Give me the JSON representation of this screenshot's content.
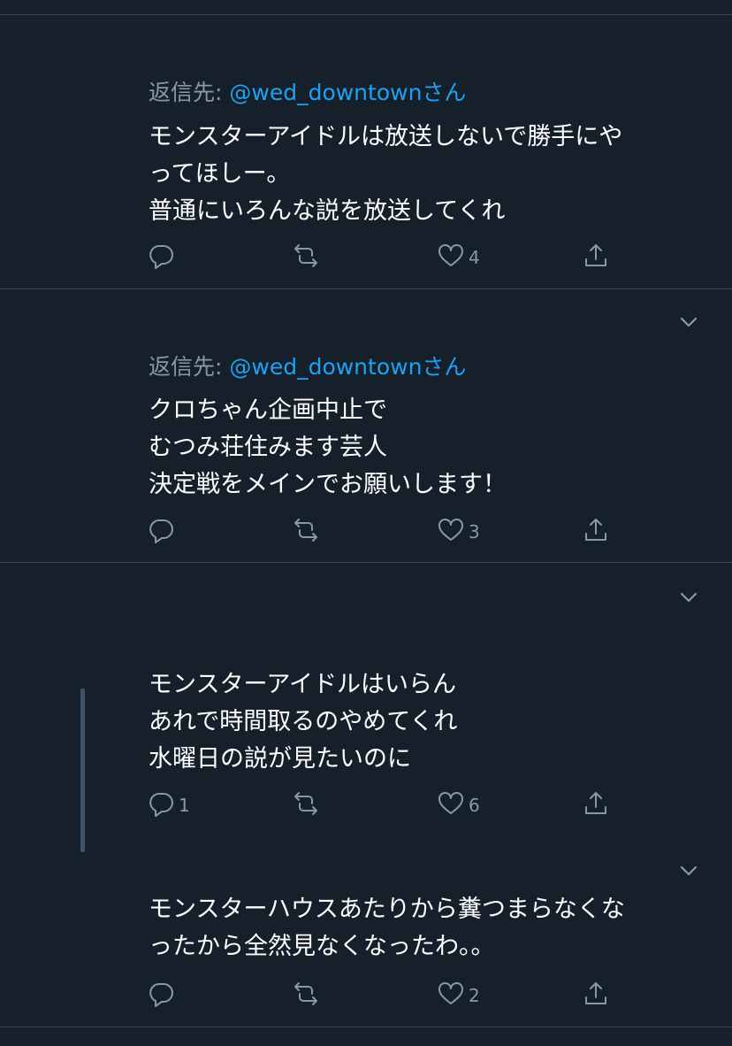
{
  "tweets": [
    {
      "reply_prefix": "返信先: ",
      "reply_handle": "@wed_downtownさん",
      "lines": [
        "モンスターアイドルは放送しないで勝手にや",
        "ってほしー。",
        "普通にいろんな説を放送してくれ"
      ],
      "reply_count": "",
      "like_count": "4"
    },
    {
      "reply_prefix": "返信先: ",
      "reply_handle": "@wed_downtownさん",
      "lines": [
        "クロちゃん企画中止で",
        "むつみ荘住みます芸人",
        "決定戦をメインでお願いします！"
      ],
      "reply_count": "",
      "like_count": "3"
    },
    {
      "lines": [
        "モンスターアイドルはいらん",
        "あれで時間取るのやめてくれ",
        "水曜日の説が見たいのに"
      ],
      "reply_count": "1",
      "like_count": "6"
    },
    {
      "lines": [
        "モンスターハウスあたりから糞つまらなくな",
        "ったから全然見なくなったわ。。"
      ],
      "reply_count": "",
      "like_count": "2"
    }
  ],
  "icons": {
    "reply": "reply-icon",
    "retweet": "retweet-icon",
    "like": "heart-icon",
    "share": "share-icon",
    "more": "chevron-down-icon"
  },
  "colors": {
    "background": "#15202b",
    "divider": "#38444d",
    "text": "#ffffff",
    "secondary": "#8899a6",
    "link": "#1da1f2"
  }
}
